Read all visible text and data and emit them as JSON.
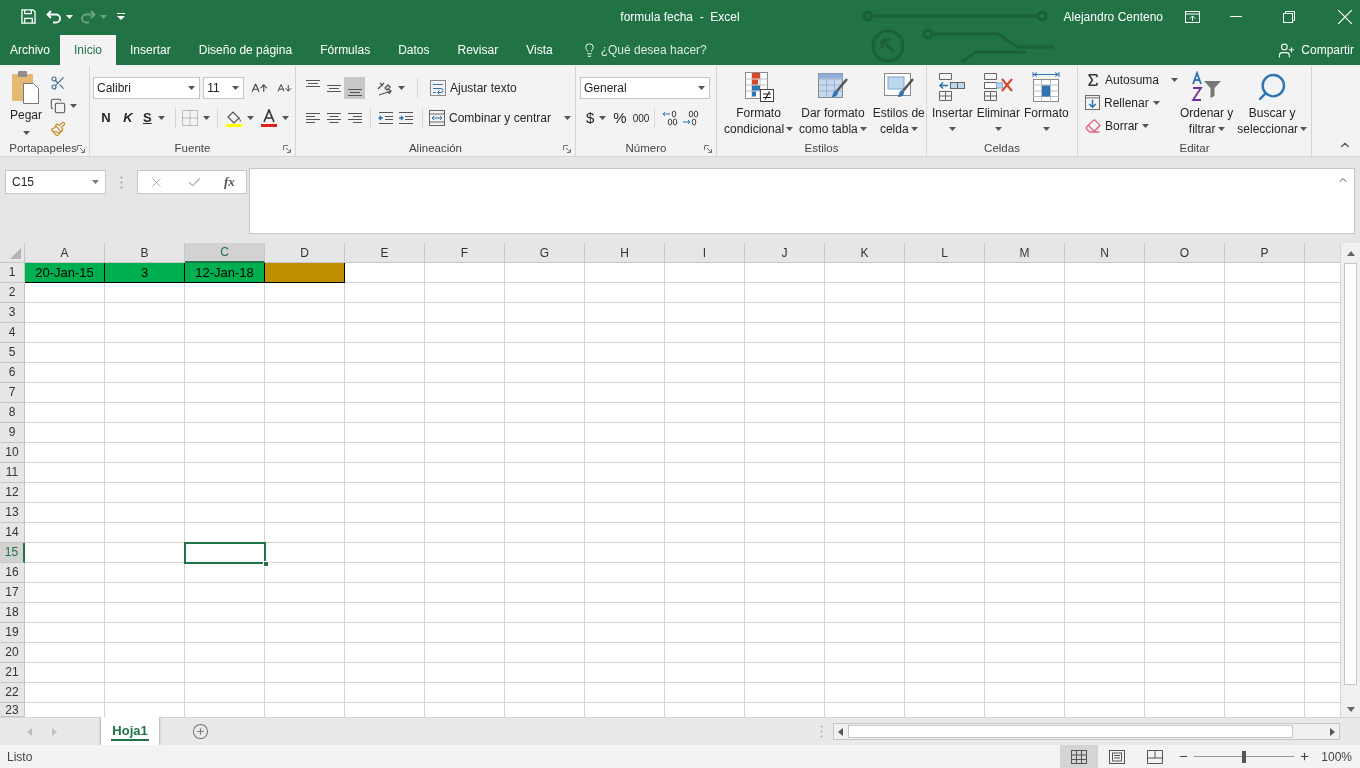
{
  "title_bar": {
    "quick_access": [
      {
        "kind": "save",
        "disabled": false
      },
      {
        "kind": "undo",
        "disabled": false
      },
      {
        "kind": "redo",
        "disabled": true
      },
      {
        "kind": "customize",
        "disabled": false
      }
    ],
    "title": "formula fecha  -  Excel",
    "user": "Alejandro Centeno"
  },
  "tabs": [
    {
      "label": "Archivo",
      "selected": false
    },
    {
      "label": "Inicio",
      "selected": true
    },
    {
      "label": "Insertar",
      "selected": false
    },
    {
      "label": "Diseño de página",
      "selected": false
    },
    {
      "label": "Fórmulas",
      "selected": false
    },
    {
      "label": "Datos",
      "selected": false
    },
    {
      "label": "Revisar",
      "selected": false
    },
    {
      "label": "Vista",
      "selected": false
    }
  ],
  "tell_me": {
    "placeholder": "¿Qué desea hacer?"
  },
  "share": {
    "label": "Compartir"
  },
  "ribbon": {
    "clipboard": {
      "label": "Portapapeles",
      "paste": "Pegar"
    },
    "font": {
      "label": "Fuente",
      "font_name": "Calibri",
      "font_size": "11",
      "bold": "N",
      "italic": "K",
      "underline": "S"
    },
    "alignment": {
      "label": "Alineación",
      "vertical": [
        {
          "kind": "top",
          "selected": false
        },
        {
          "kind": "middle",
          "selected": false
        },
        {
          "kind": "bottom",
          "selected": true
        }
      ],
      "horizontal": [
        {
          "kind": "left",
          "selected": false
        },
        {
          "kind": "center",
          "selected": false
        },
        {
          "kind": "right",
          "selected": false
        }
      ],
      "wrap_text": "Ajustar texto",
      "merge": "Combinar y centrar"
    },
    "number": {
      "label": "Número",
      "format": "General",
      "currency": "$",
      "percent": "%",
      "thousands": "000"
    },
    "styles": {
      "label": "Estilos",
      "buttons": [
        {
          "kind": "conditional",
          "lines": [
            "Formato",
            "condicional"
          ]
        },
        {
          "kind": "table",
          "lines": [
            "Dar formato",
            "como tabla"
          ]
        },
        {
          "kind": "cell_styles",
          "lines": [
            "Estilos de",
            "celda"
          ]
        }
      ]
    },
    "cells": {
      "label": "Celdas",
      "buttons": [
        {
          "kind": "insert",
          "label": "Insertar"
        },
        {
          "kind": "delete",
          "label": "Eliminar"
        },
        {
          "kind": "format",
          "label": "Formato"
        }
      ]
    },
    "editing": {
      "label": "Editar",
      "small": [
        {
          "kind": "autosum",
          "label": "Autosuma"
        },
        {
          "kind": "fill",
          "label": "Rellenar"
        },
        {
          "kind": "clear",
          "label": "Borrar"
        }
      ],
      "big": [
        {
          "kind": "sort",
          "lines": [
            "Ordenar y",
            "filtrar"
          ]
        },
        {
          "kind": "find",
          "lines": [
            "Buscar y",
            "seleccionar"
          ]
        }
      ]
    }
  },
  "formula_bar": {
    "name_box": "C15",
    "function_button": "fx"
  },
  "sheet": {
    "columns": [
      {
        "label": "A",
        "selected": false
      },
      {
        "label": "B",
        "selected": false
      },
      {
        "label": "C",
        "selected": true
      },
      {
        "label": "D",
        "selected": false
      },
      {
        "label": "E",
        "selected": false
      },
      {
        "label": "F",
        "selected": false
      },
      {
        "label": "G",
        "selected": false
      },
      {
        "label": "H",
        "selected": false
      },
      {
        "label": "I",
        "selected": false
      },
      {
        "label": "J",
        "selected": false
      },
      {
        "label": "K",
        "selected": false
      },
      {
        "label": "L",
        "selected": false
      },
      {
        "label": "M",
        "selected": false
      },
      {
        "label": "N",
        "selected": false
      },
      {
        "label": "O",
        "selected": false
      },
      {
        "label": "P",
        "selected": false
      }
    ],
    "rows": [
      {
        "label": "1",
        "selected": false,
        "cells": [
          {
            "value": "20-Jan-15",
            "color": "#00b050"
          },
          {
            "value": "3",
            "color": "#00b050"
          },
          {
            "value": "12-Jan-18",
            "color": "#00b050"
          },
          {
            "color": "#bf8f00"
          }
        ]
      },
      {
        "label": "2",
        "selected": false
      },
      {
        "label": "3",
        "selected": false
      },
      {
        "label": "4",
        "selected": false
      },
      {
        "label": "5",
        "selected": false
      },
      {
        "label": "6",
        "selected": false
      },
      {
        "label": "7",
        "selected": false
      },
      {
        "label": "8",
        "selected": false
      },
      {
        "label": "9",
        "selected": false
      },
      {
        "label": "10",
        "selected": false
      },
      {
        "label": "11",
        "selected": false
      },
      {
        "label": "12",
        "selected": false
      },
      {
        "label": "13",
        "selected": false
      },
      {
        "label": "14",
        "selected": false
      },
      {
        "label": "15",
        "selected": true
      },
      {
        "label": "16",
        "selected": false
      },
      {
        "label": "17",
        "selected": false
      },
      {
        "label": "18",
        "selected": false
      },
      {
        "label": "19",
        "selected": false
      },
      {
        "label": "20",
        "selected": false
      },
      {
        "label": "21",
        "selected": false
      },
      {
        "label": "22",
        "selected": false
      },
      {
        "label": "23",
        "selected": false
      }
    ]
  },
  "sheet_tabs": [
    {
      "label": "Hoja1",
      "selected": true
    }
  ],
  "status_bar": {
    "status": "Listo",
    "views": [
      {
        "kind": "normal",
        "selected": true
      },
      {
        "kind": "page_layout",
        "selected": false
      },
      {
        "kind": "page_break",
        "selected": false
      }
    ],
    "zoom": {
      "level": 0.5,
      "label": "100%"
    }
  }
}
